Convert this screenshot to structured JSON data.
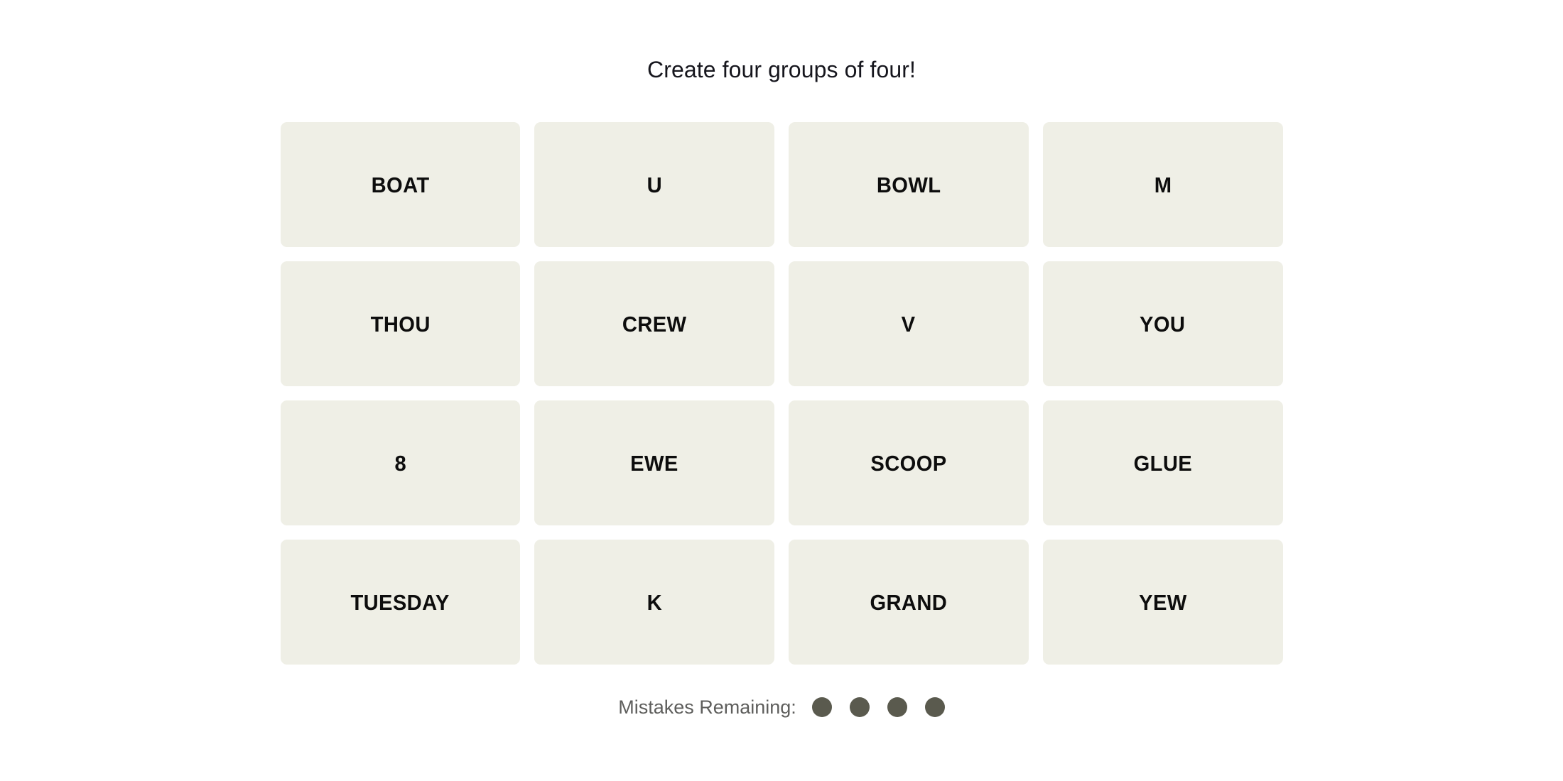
{
  "header": {
    "instruction": "Create four groups of four!"
  },
  "board": {
    "rows": 4,
    "columns": 4,
    "tile_background": "#EFEFE6",
    "tile_text_color": "#0D0D0D",
    "tiles": [
      {
        "label": "BOAT"
      },
      {
        "label": "U"
      },
      {
        "label": "BOWL"
      },
      {
        "label": "M"
      },
      {
        "label": "THOU"
      },
      {
        "label": "CREW"
      },
      {
        "label": "V"
      },
      {
        "label": "YOU"
      },
      {
        "label": "8"
      },
      {
        "label": "EWE"
      },
      {
        "label": "SCOOP"
      },
      {
        "label": "GLUE"
      },
      {
        "label": "TUESDAY"
      },
      {
        "label": "K"
      },
      {
        "label": "GRAND"
      },
      {
        "label": "YEW"
      }
    ]
  },
  "footer": {
    "mistakes_label": "Mistakes Remaining:",
    "mistakes_remaining": 4,
    "mistakes_total": 4,
    "dot_color": "#5A5A4E",
    "dots": [
      {
        "state": "remaining"
      },
      {
        "state": "remaining"
      },
      {
        "state": "remaining"
      },
      {
        "state": "remaining"
      }
    ]
  }
}
